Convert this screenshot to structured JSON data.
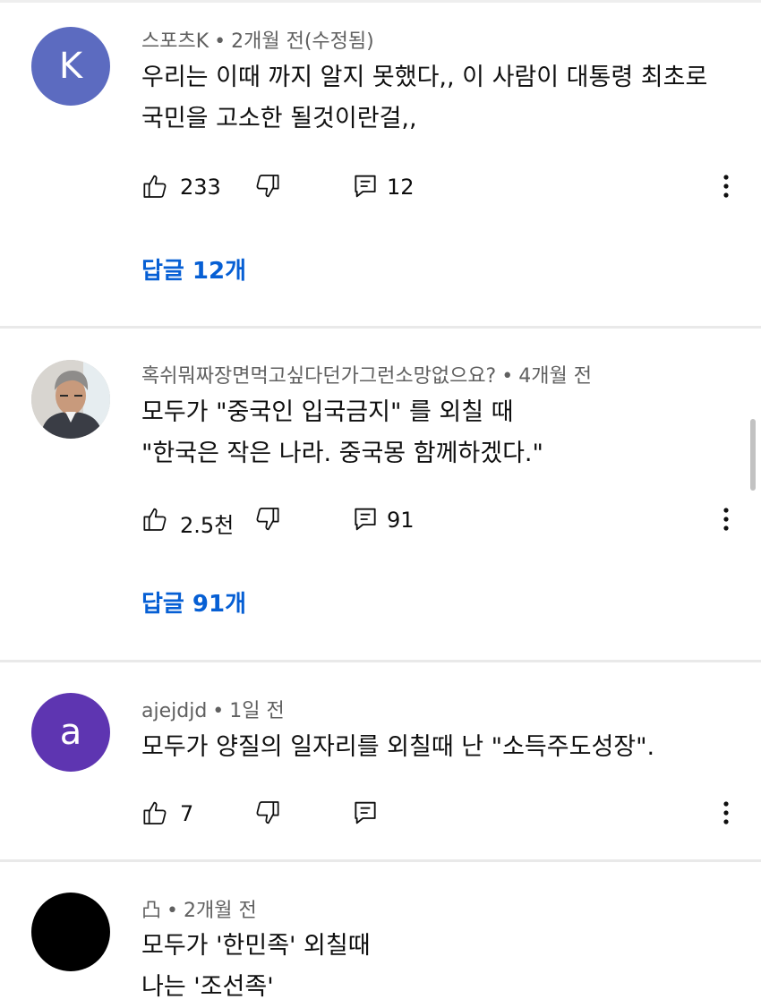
{
  "colors": {
    "link": "#065fd4",
    "meta_text": "#606060",
    "divider": "#e9e9e9"
  },
  "comments": [
    {
      "author": "스포츠K",
      "separator": "•",
      "time": "2개월 전(수정됨)",
      "avatar_letter": "K",
      "avatar_color": "#5c6bc0",
      "lines": [
        "우리는 이때 까지 알지 못했다,, 이 사람이 대통령 최초로",
        "국민을 고소한 될것이란걸,,"
      ],
      "likes": "233",
      "reply_count": "12",
      "replies_label": "답글 12개"
    },
    {
      "author": "혹쉬뭐짜장면먹고싶다던가그런소망없으요?",
      "separator": "•",
      "time": "4개월 전",
      "avatar_letter": "",
      "avatar_color": "#b9b3ad",
      "avatar_icon": "user-photo-avatar",
      "lines": [
        "모두가 \"중국인 입국금지\" 를 외칠 때",
        "\"한국은 작은 나라. 중국몽 함께하겠다.\""
      ],
      "likes": "2.5천",
      "reply_count": "91",
      "replies_label": "답글 91개"
    },
    {
      "author": "ajejdjd",
      "separator": "•",
      "time": "1일 전",
      "avatar_letter": "a",
      "avatar_color": "#5e35b1",
      "lines": [
        "모두가 양질의 일자리를 외칠때 난 \"소득주도성장\"."
      ],
      "likes": "7",
      "reply_count": "",
      "replies_label": ""
    },
    {
      "author": "凸",
      "separator": "•",
      "time": "2개월 전",
      "avatar_letter": "",
      "avatar_color": "#000000",
      "lines": [
        "모두가 '한민족' 외칠때",
        "나는 '조선족'"
      ],
      "likes": "",
      "reply_count": "",
      "replies_label": ""
    }
  ],
  "icons": {
    "like": "thumb-up-icon",
    "dislike": "thumb-down-icon",
    "reply": "reply-comment-icon",
    "more": "more-vert-icon"
  }
}
